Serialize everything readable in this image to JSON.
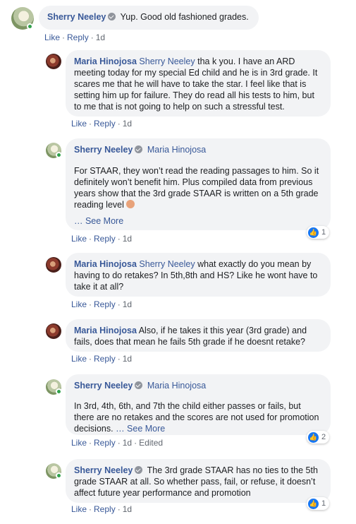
{
  "comments": [
    {
      "author": "Sherry Neeley",
      "verified": true,
      "text": "Yup. Good old fashioned grades.",
      "actions": {
        "like": "Like",
        "reply": "Reply",
        "time": "1d"
      }
    },
    {
      "author": "Maria Hinojosa",
      "mention": "Sherry Neeley",
      "text": "tha k you. I have an ARD meeting today for my special Ed child and he is in 3rd grade. It scares me that he will have to take the star. I feel like that is setting him up for failure. They do read all his tests to him, but to me that is not going to help on such a stressful test.",
      "actions": {
        "like": "Like",
        "reply": "Reply",
        "time": "1d"
      }
    },
    {
      "author": "Sherry Neeley",
      "verified": true,
      "mention": "Maria Hinojosa",
      "text": "For STAAR, they won’t read the reading passages to him. So it definitely won’t benefit him. Plus compiled data from previous years show that the 3rd grade STAAR is written on a 5th grade reading level",
      "see_more": "… See More",
      "reaction_count": "1",
      "actions": {
        "like": "Like",
        "reply": "Reply",
        "time": "1d"
      }
    },
    {
      "author": "Maria Hinojosa",
      "mention": "Sherry Neeley",
      "text": "what exactly do you mean by having to do retakes? In 5th,8th and HS? Like he wont have to take it at all?",
      "actions": {
        "like": "Like",
        "reply": "Reply",
        "time": "1d"
      }
    },
    {
      "author": "Maria Hinojosa",
      "text": "Also, if he takes it this year (3rd grade) and fails, does that mean he fails 5th grade if he doesnt retake?",
      "actions": {
        "like": "Like",
        "reply": "Reply",
        "time": "1d"
      }
    },
    {
      "author": "Sherry Neeley",
      "verified": true,
      "mention": "Maria Hinojosa",
      "text": "In 3rd, 4th, 6th, and 7th the child either passes or fails, but there are no retakes and the scores are not used for promotion decisions.",
      "see_more": "… See More",
      "reaction_count": "2",
      "actions": {
        "like": "Like",
        "reply": "Reply",
        "time": "1d",
        "edited": "Edited"
      }
    },
    {
      "author": "Sherry Neeley",
      "verified": true,
      "text": "The 3rd grade STAAR has no ties to the 5th grade STAAR at all. So whether pass, fail, or refuse, it doesn’t affect future year performance and promotion",
      "reaction_count": "1",
      "actions": {
        "like": "Like",
        "reply": "Reply",
        "time": "1d"
      }
    }
  ],
  "colors": {
    "link": "#385898",
    "bubble": "#f2f3f5",
    "meta": "#616770",
    "online": "#31a24c",
    "like": "#1877f2"
  },
  "icons": {
    "verified": "verified-badge-icon",
    "like": "thumbs-up-icon",
    "emoji": "woman-facepalming-emoji"
  }
}
